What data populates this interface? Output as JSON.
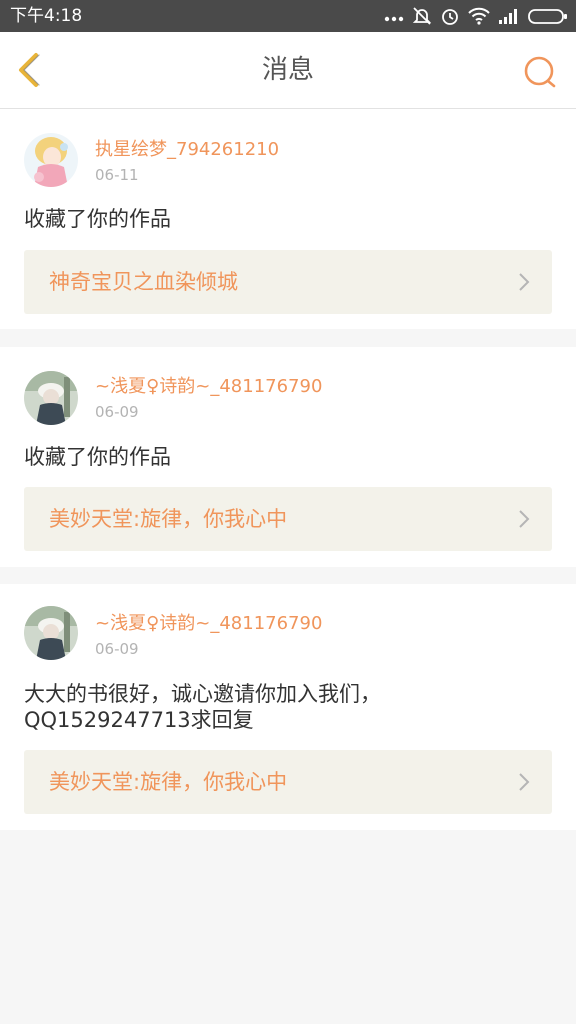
{
  "status_bar": {
    "time": "下午4:18",
    "icons": [
      "more-dots-icon",
      "mute-icon",
      "alarm-icon",
      "wifi-icon",
      "signal-icon",
      "battery-icon"
    ]
  },
  "header": {
    "title": "消息",
    "back_icon": "chevron-left-icon",
    "search_icon": "search-icon"
  },
  "colors": {
    "accent": "#f0955b",
    "back_icon": "#e8b43a",
    "status_bar_bg": "#4a4a4a",
    "page_bg": "#f6f6f6",
    "link_bg": "#f3f2ea"
  },
  "notifications": [
    {
      "username": "执星绘梦_794261210",
      "date": "06-11",
      "message": "收藏了你的作品",
      "work_title": "神奇宝贝之血染倾城"
    },
    {
      "username": "~浅夏♀诗韵~_481176790",
      "date": "06-09",
      "message": "收藏了你的作品",
      "work_title": "美妙天堂:旋律，你我心中"
    },
    {
      "username": "~浅夏♀诗韵~_481176790",
      "date": "06-09",
      "message_line1": "大大的书很好，诚心邀请你加入我们，",
      "message_line2": "QQ1529247713求回复",
      "work_title": "美妙天堂:旋律，你我心中"
    }
  ]
}
